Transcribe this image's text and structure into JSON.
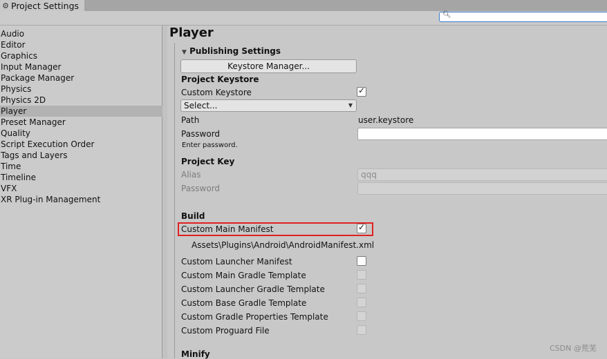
{
  "window": {
    "tab_title": "Project Settings"
  },
  "search": {
    "placeholder": ""
  },
  "sidebar": {
    "items": [
      {
        "label": "Audio"
      },
      {
        "label": "Editor"
      },
      {
        "label": "Graphics"
      },
      {
        "label": "Input Manager"
      },
      {
        "label": "Package Manager"
      },
      {
        "label": "Physics"
      },
      {
        "label": "Physics 2D"
      },
      {
        "label": "Player"
      },
      {
        "label": "Preset Manager"
      },
      {
        "label": "Quality"
      },
      {
        "label": "Script Execution Order"
      },
      {
        "label": "Tags and Layers"
      },
      {
        "label": "Time"
      },
      {
        "label": "Timeline"
      },
      {
        "label": "VFX"
      },
      {
        "label": "XR Plug-in Management"
      }
    ],
    "selected": "Player"
  },
  "main": {
    "title": "Player",
    "publishing": {
      "header": "Publishing Settings",
      "keystore_button": "Keystore Manager...",
      "project_keystore_heading": "Project Keystore",
      "custom_keystore_label": "Custom Keystore",
      "custom_keystore_checked": true,
      "select_value": "Select...",
      "path_label": "Path",
      "path_value": "user.keystore",
      "password_label": "Password",
      "password_value": "",
      "enter_password_hint": "Enter password.",
      "project_key_heading": "Project Key",
      "alias_label": "Alias",
      "alias_value": "qqq",
      "key_password_label": "Password",
      "key_password_value": ""
    },
    "build": {
      "heading": "Build",
      "custom_main_manifest_label": "Custom Main Manifest",
      "custom_main_manifest_checked": true,
      "manifest_path": "Assets\\Plugins\\Android\\AndroidManifest.xml",
      "custom_launcher_manifest": "Custom Launcher Manifest",
      "custom_main_gradle_template": "Custom Main Gradle Template",
      "custom_launcher_gradle_template": "Custom Launcher Gradle Template",
      "custom_base_gradle_template": "Custom Base Gradle Template",
      "custom_gradle_properties_template": "Custom Gradle Properties Template",
      "custom_proguard_file": "Custom Proguard File"
    },
    "minify_heading": "Minify"
  },
  "watermark": "CSDN @荒芜",
  "colors": {
    "highlight": "#e02020",
    "selected_row": "#b2b2b2",
    "search_border": "#3a79c8"
  }
}
